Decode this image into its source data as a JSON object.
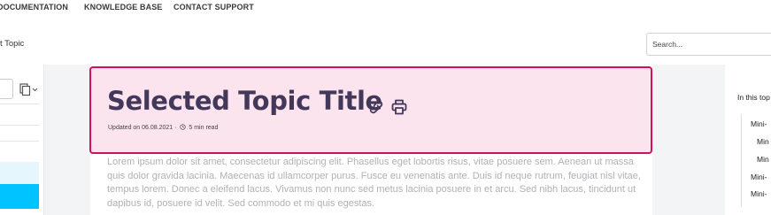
{
  "nav": {
    "documentation": "DOCUMENTATION",
    "knowledge_base": "KNOWLEDGE BASE",
    "contact_support": "CONTACT SUPPORT"
  },
  "breadcrumb": "t Topic",
  "search": {
    "placeholder": "Search..."
  },
  "article": {
    "title": "Selected Topic Title",
    "updated": "Updated on 06.08.2021",
    "separator": "·",
    "read_time": "5 min read",
    "body": "Lorem ipsum dolor sit amet, consectetur adipiscing elit. Phasellus eget lobortis risus, vitae posuere sem. Aenean ut massa quis dolor gravida lacinia. Maecenas id ullamcorper purus. Fusce eu venenatis ante. Duis id neque rutrum, feugiat nisl vitae, tempus lorem. Donec a eleifend lacus. Vivamus non nunc sed metus lacinia posuere in et arcu. Sed nibh lacus, tincidunt ut dapibus id, posuere id velit. Sed commodo et mi quis egestas."
  },
  "toc": {
    "title": "In this top",
    "items": [
      "Mini-",
      "Min",
      "Min",
      "Mini-",
      "Mini-"
    ]
  },
  "colors": {
    "accent": "#d0125e",
    "title_card_bg": "#fbe4ee",
    "title_text": "#44385a",
    "sidebar_highlight_light": "#e6f6fd",
    "sidebar_highlight": "#00c3ff"
  }
}
